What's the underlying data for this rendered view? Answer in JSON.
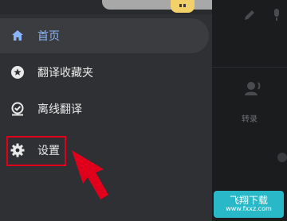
{
  "menu": {
    "items": [
      {
        "label": "首页",
        "icon": "home-icon",
        "active": true
      },
      {
        "label": "翻译收藏夹",
        "icon": "star-badge-icon",
        "active": false
      },
      {
        "label": "离线翻译",
        "icon": "offline-check-icon",
        "active": false
      },
      {
        "label": "设置",
        "icon": "gear-icon",
        "active": false
      }
    ]
  },
  "right_panel": {
    "voice_label": "转录"
  },
  "watermark": {
    "text": "飞翔下载",
    "sub": "www.fxxz.com"
  },
  "colors": {
    "drawer_bg": "#2f3033",
    "active_text": "#8ab4f8",
    "highlight": "#e0001b",
    "avatar": "#f2d16b"
  }
}
